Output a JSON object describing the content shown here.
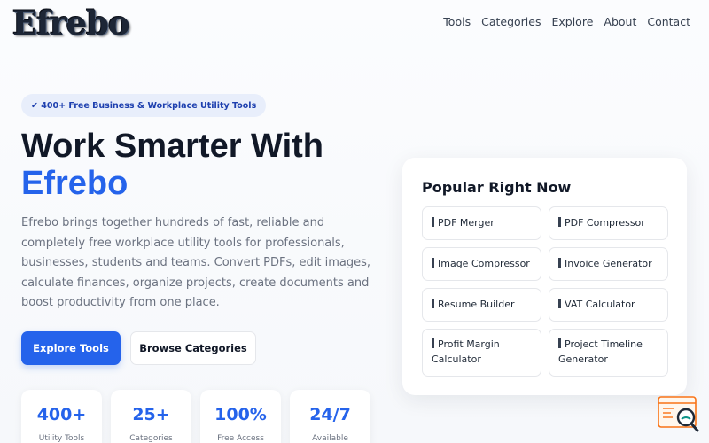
{
  "header": {
    "logo": "Efrebo",
    "nav": [
      "Tools",
      "Categories",
      "Explore",
      "About",
      "Contact"
    ]
  },
  "hero": {
    "badge": "✔ 400+ Free Business & Workplace Utility Tools",
    "title_line1": "Work Smarter With",
    "title_line2": "Efrebo",
    "description": "Efrebo brings together hundreds of fast, reliable and completely free workplace utility tools for professionals, businesses, students and teams. Convert PDFs, edit images, calculate finances, organize projects, create documents and boost productivity from one place.",
    "primary_button": "Explore Tools",
    "secondary_button": "Browse Categories"
  },
  "stats": [
    {
      "value": "400+",
      "label": "Utility Tools"
    },
    {
      "value": "25+",
      "label": "Categories"
    },
    {
      "value": "100%",
      "label": "Free Access"
    },
    {
      "value": "24/7",
      "label": "Available"
    }
  ],
  "popular": {
    "title": "Popular Right Now",
    "tools": [
      "PDF Merger",
      "PDF Compressor",
      "Image Compressor",
      "Invoice Generator",
      "Resume Builder",
      "VAT Calculator",
      "Profit Margin Calculator",
      "Project Timeline Generator"
    ]
  },
  "colors": {
    "accent": "#2563eb",
    "badge_bg": "#e8eefb",
    "widget": "#f97316"
  },
  "icons": {
    "widget": "search-magnifier-icon"
  }
}
